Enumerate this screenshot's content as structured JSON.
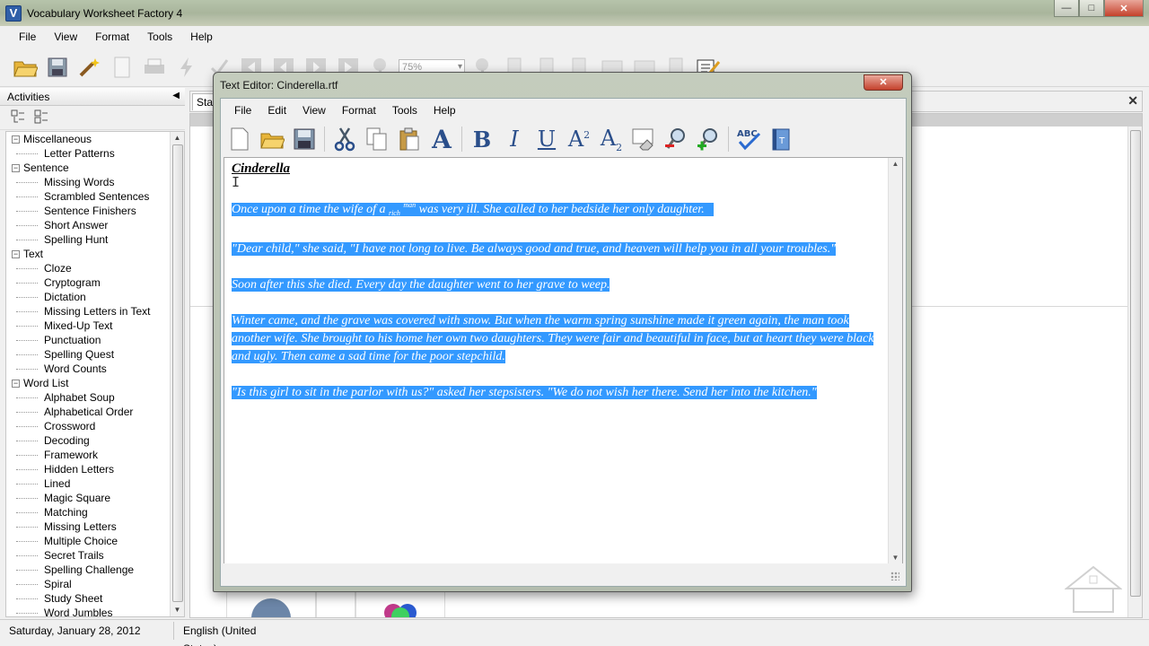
{
  "app": {
    "title": "Vocabulary Worksheet Factory 4"
  },
  "main_menu": [
    "File",
    "View",
    "Format",
    "Tools",
    "Help"
  ],
  "toolbar": {
    "zoom_value": "75%"
  },
  "activities": {
    "header": "Activities",
    "tree": [
      {
        "label": "Miscellaneous",
        "children": [
          "Letter Patterns"
        ]
      },
      {
        "label": "Sentence",
        "children": [
          "Missing Words",
          "Scrambled Sentences",
          "Sentence Finishers",
          "Short Answer",
          "Spelling Hunt"
        ]
      },
      {
        "label": "Text",
        "children": [
          "Cloze",
          "Cryptogram",
          "Dictation",
          "Missing Letters in Text",
          "Mixed-Up Text",
          "Punctuation",
          "Spelling Quest",
          "Word Counts"
        ]
      },
      {
        "label": "Word List",
        "children": [
          "Alphabet Soup",
          "Alphabetical Order",
          "Crossword",
          "Decoding",
          "Framework",
          "Hidden Letters",
          "Lined",
          "Magic Square",
          "Matching",
          "Missing Letters",
          "Multiple Choice",
          "Secret Trails",
          "Spelling Challenge",
          "Spiral",
          "Study Sheet",
          "Word Jumbles"
        ]
      }
    ]
  },
  "doc_tab": {
    "label": "Star"
  },
  "status": {
    "date": "Saturday, January 28, 2012",
    "language": "English (United States)"
  },
  "editor": {
    "title": "Text Editor: Cinderella.rtf",
    "menu": [
      "File",
      "Edit",
      "View",
      "Format",
      "Tools",
      "Help"
    ],
    "heading": "Cinderella",
    "p1_a": "Once upon a time the wife of a ",
    "p1_sub": "rich",
    "p1_sup": "man",
    "p1_b": " was very ill.  She called to her bedside her only daughter.",
    "p2": "\"Dear child,\" she said, \"I have not long to live.  Be always good and true, and heaven will help you in all your troubles.\"",
    "p3": "Soon after this she died.  Every day the daughter went to her grave to weep.",
    "p4": "Winter came, and the grave was covered with snow.  But when the warm spring sunshine made it green again, the man took another wife.  She brought to his home her own two daughters.  They were fair and beautiful in face, but at heart they were black and ugly.  Then came a sad time for the poor stepchild.",
    "p5": "\"Is this girl to sit in the parlor with us?\" asked her stepsisters.  \"We do not wish her there.  Send her into the kitchen.\"",
    "spell_label": "ABC"
  }
}
